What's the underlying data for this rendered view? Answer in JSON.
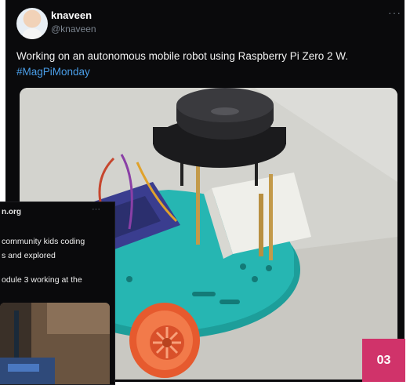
{
  "main_tweet": {
    "display_name": "knaveen",
    "handle": "@knaveen",
    "text": "Working on an autonomous mobile robot using Raspberry Pi Zero 2 W.",
    "hashtag": "#MagPiMonday",
    "more_icon": "more-horizontal-icon",
    "photo_subject": "robot-photo"
  },
  "second_tweet": {
    "handle_fragment": "n.org",
    "lines": [
      "community kids coding",
      "s and explored",
      "odule 3 working at the"
    ],
    "more_icon": "more-horizontal-icon"
  },
  "badge": {
    "number": "03",
    "color": "#d0336a"
  },
  "colors": {
    "tweet_bg": "#0a0a0c",
    "hashtag": "#4a9ee8",
    "robot_chassis": "#23b4b0",
    "wheel": "#f26a3d"
  }
}
